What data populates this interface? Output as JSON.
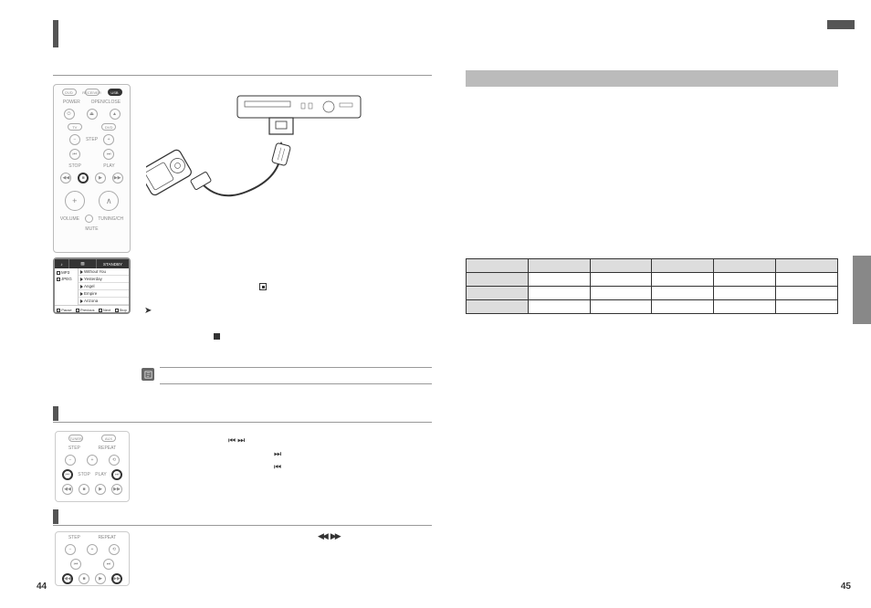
{
  "page_numbers": {
    "left": "44",
    "right": "45"
  },
  "remote": {
    "top_buttons": [
      "DVD",
      "RECEIVER",
      "USB"
    ],
    "row_labels": [
      "POWER",
      "OPEN/CLOSE",
      "EJECT"
    ],
    "tv_dvd": [
      "TV",
      "DVD"
    ],
    "step": "STEP",
    "stop": "STOP",
    "play": "PLAY",
    "volume": "VOLUME",
    "mute": "MUTE",
    "tuning": "TUNING/CH"
  },
  "screen": {
    "header": [
      "",
      "",
      "STANDBY"
    ],
    "left_items": [
      "MP3",
      "JPEG"
    ],
    "right_items": [
      "Without You",
      "Yesterday",
      "Angel",
      "Empire",
      "Arizona"
    ],
    "footer": [
      "Pause",
      "Previous",
      "Next",
      "Stop"
    ]
  },
  "icons": {
    "skip_prev": "⏮",
    "skip_next": "⏭",
    "rewind": "◀◀",
    "fast_forward": "▶▶"
  },
  "table": {
    "headers": [
      "",
      "",
      "",
      "",
      "",
      ""
    ],
    "rows": [
      [
        "",
        "",
        "",
        "",
        "",
        ""
      ],
      [
        "",
        "",
        "",
        "",
        "",
        ""
      ],
      [
        "",
        "",
        "",
        "",
        "",
        ""
      ]
    ]
  }
}
